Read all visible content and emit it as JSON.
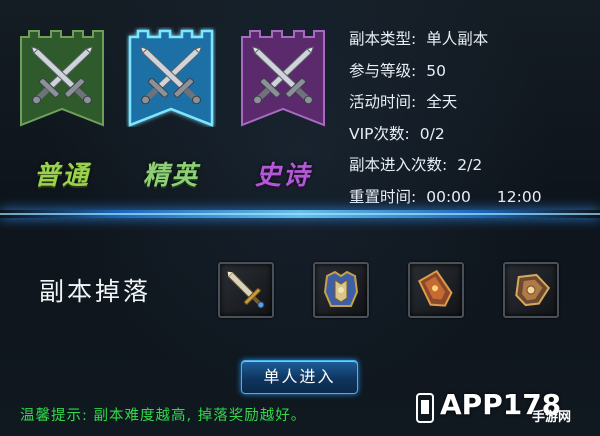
{
  "modes": [
    {
      "key": "normal",
      "label": "普通",
      "color": "#3f7d3a",
      "icon": "crossed-swords-icon",
      "selected": false
    },
    {
      "key": "elite",
      "label": "精英",
      "color": "#2b8fc8",
      "icon": "crossed-swords-icon",
      "selected": true
    },
    {
      "key": "epic",
      "label": "史诗",
      "color": "#7a3c8f",
      "icon": "crossed-swords-icon",
      "selected": false
    }
  ],
  "info": {
    "type_label": "副本类型:",
    "type_value": "单人副本",
    "level_label": "参与等级:",
    "level_value": "50",
    "time_label": "活动时间:",
    "time_value": "全天",
    "vip_label": "VIP次数:",
    "vip_value": "0/2",
    "enter_label": "副本进入次数:",
    "enter_value": "2/2",
    "reset_label": "重置时间:",
    "reset_value_1": "00:00",
    "reset_value_2": "12:00"
  },
  "drops": {
    "title": "副本掉落",
    "items": [
      {
        "icon": "sword-item-icon"
      },
      {
        "icon": "armor-item-icon"
      },
      {
        "icon": "gauntlet-item-icon"
      },
      {
        "icon": "accessory-item-icon"
      }
    ]
  },
  "enter_button": "单人进入",
  "tip": "温馨提示: 副本难度越高, 掉落奖励越好。",
  "watermark": {
    "brand": "APP178",
    "sub": "手游网"
  },
  "colors": {
    "accent": "#2f8ff0",
    "tip": "#33d84a"
  }
}
